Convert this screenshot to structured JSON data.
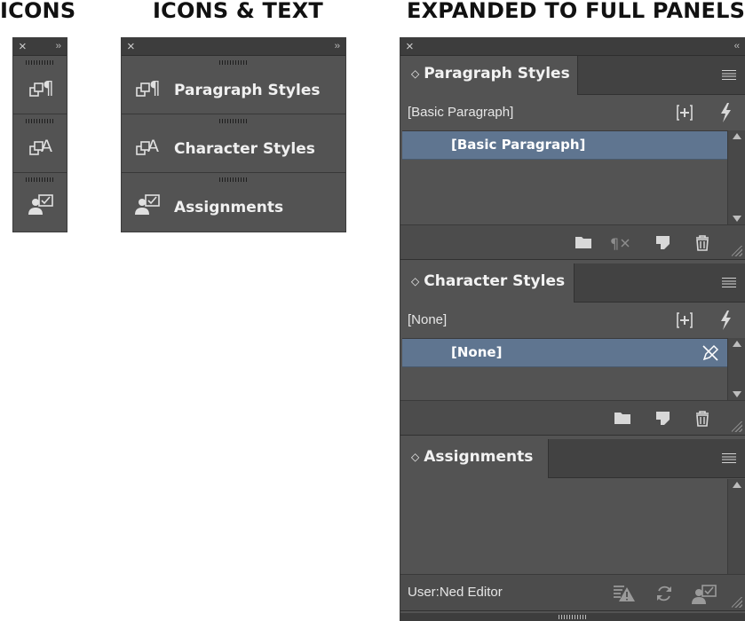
{
  "headings": {
    "icons": "ICONS",
    "icons_text": "ICONS & TEXT",
    "expanded": "EXPANDED TO FULL PANELS"
  },
  "topbar": {
    "close_glyph": "×",
    "collapse_glyph": "››",
    "expand_glyph": "‹‹"
  },
  "panels": [
    {
      "name": "paragraph-styles",
      "label": "Paragraph Styles",
      "icon": "paragraph-styles-icon"
    },
    {
      "name": "character-styles",
      "label": "Character Styles",
      "icon": "character-styles-icon"
    },
    {
      "name": "assignments",
      "label": "Assignments",
      "icon": "assignments-icon"
    }
  ],
  "expanded": {
    "paragraph": {
      "tab_label": "Paragraph Styles",
      "current": "[Basic Paragraph]",
      "items": [
        "[Basic Paragraph]"
      ],
      "footer_icons": [
        "folder-icon",
        "clear-overrides-icon",
        "new-style-icon",
        "trash-icon"
      ]
    },
    "character": {
      "tab_label": "Character Styles",
      "current": "[None]",
      "items": [
        "[None]"
      ],
      "footer_icons": [
        "folder-icon",
        "new-style-icon",
        "trash-icon"
      ]
    },
    "assignments": {
      "tab_label": "Assignments",
      "user_label": "User:Ned Editor",
      "footer_icons": [
        "warning-icon",
        "update-icon",
        "assignments-icon"
      ]
    }
  },
  "colors": {
    "panel_bg": "#535353",
    "titlebar_bg": "#3d3d3d",
    "selection": "#5f7590",
    "text": "#f0f0f0"
  }
}
